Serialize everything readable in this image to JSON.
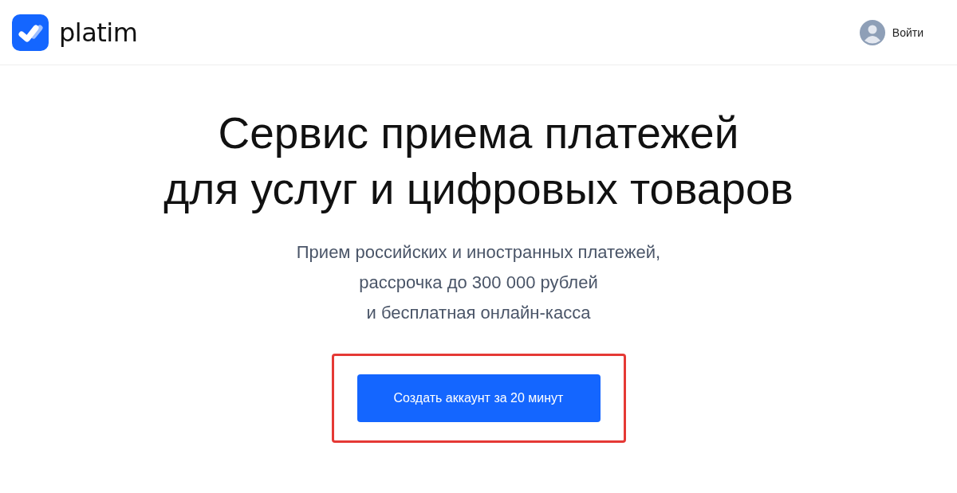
{
  "header": {
    "logo_text": "platim",
    "login": "Войти"
  },
  "hero": {
    "title_lines": [
      "Сервис приема платежей",
      "для услуг и цифровых товаров"
    ],
    "subtitle_lines": [
      "Прием российских и иностранных платежей,",
      "рассрочка до 300 000 рублей",
      "и бесплатная онлайн-касса"
    ],
    "cta": {
      "label": "Создать аккаунт за 20 минут",
      "highlighted": true
    }
  }
}
